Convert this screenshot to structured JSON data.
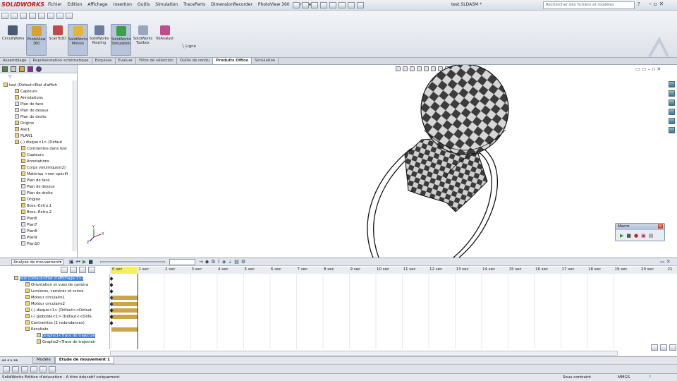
{
  "app": {
    "logo": "SOLIDWORKS",
    "doc_title": "test.SLDASM *"
  },
  "menu": [
    "Fichier",
    "Edition",
    "Affichage",
    "Insertion",
    "Outils",
    "Simulation",
    "TraceParts",
    "DimensionRecorder",
    "PhotoView 360",
    "Fenêtre"
  ],
  "search": {
    "placeholder": "Rechercher des fichiers et modèles"
  },
  "ribbon": {
    "buttons": [
      {
        "label": "CircuitWorks",
        "color": "#4a5b75",
        "active": false
      },
      {
        "label": "PhotoView 360",
        "color": "#d7a22d",
        "active": true
      },
      {
        "label": "ScanTo3D",
        "color": "#c44848",
        "active": false
      },
      {
        "label": "SolidWorks Motion",
        "color": "#e4b535",
        "active": true
      },
      {
        "label": "SolidWorks Routing",
        "color": "#6c7da0",
        "active": false
      },
      {
        "label": "SolidWorks Simulation",
        "color": "#3aa04a",
        "active": true
      },
      {
        "label": "SolidWorks Toolbox",
        "color": "#9aa8be",
        "active": false
      },
      {
        "label": "TolAnalyst",
        "color": "#c44a8e",
        "active": false
      }
    ],
    "ligne": "Ligne"
  },
  "tabs": [
    {
      "label": "Assemblage",
      "selected": false
    },
    {
      "label": "Représentation schématique",
      "selected": false
    },
    {
      "label": "Esquisse",
      "selected": false
    },
    {
      "label": "Evaluer",
      "selected": false
    },
    {
      "label": "Filtre de sélection",
      "selected": false
    },
    {
      "label": "Outils de rendu",
      "selected": false
    },
    {
      "label": "Produits Office",
      "selected": true
    },
    {
      "label": "Simulation",
      "selected": false
    }
  ],
  "feature_tree": [
    {
      "label": "test (Défaut<Etat d'affich",
      "level": 0
    },
    {
      "label": "Capteurs",
      "level": 1
    },
    {
      "label": "Annotations",
      "level": 1
    },
    {
      "label": "Plan de face",
      "level": 1
    },
    {
      "label": "Plan de dessus",
      "level": 1
    },
    {
      "label": "Plan de droite",
      "level": 1
    },
    {
      "label": "Origine",
      "level": 1
    },
    {
      "label": "Axe1",
      "level": 1
    },
    {
      "label": "PLAN1",
      "level": 1
    },
    {
      "label": "(-) disque<1> (Défaut",
      "level": 1
    },
    {
      "label": "Contraintes dans test",
      "level": 2
    },
    {
      "label": "Capteurs",
      "level": 2
    },
    {
      "label": "Annotations",
      "level": 2
    },
    {
      "label": "Corps volumiques(2)",
      "level": 2
    },
    {
      "label": "Matériau <non spécifi",
      "level": 2
    },
    {
      "label": "Plan de face",
      "level": 2
    },
    {
      "label": "Plan de dessus",
      "level": 2
    },
    {
      "label": "Plan de droite",
      "level": 2
    },
    {
      "label": "Origine",
      "level": 2
    },
    {
      "label": "Boss.-Extru.1",
      "level": 2
    },
    {
      "label": "Boss.-Extru.2",
      "level": 2
    },
    {
      "label": "Plan6",
      "level": 2
    },
    {
      "label": "Plan7",
      "level": 2
    },
    {
      "label": "Plan8",
      "level": 2
    },
    {
      "label": "Plan9",
      "level": 2
    },
    {
      "label": "Plan10",
      "level": 2
    }
  ],
  "macro": {
    "title": "Macro"
  },
  "motion": {
    "study_type": "Analyse de mouvement",
    "time_field": "",
    "ticks": [
      "0 sec",
      "1 sec",
      "2 sec",
      "3 sec",
      "4 sec",
      "5 sec",
      "6 sec",
      "7 sec",
      "8 sec",
      "9 sec",
      "10 sec",
      "11 sec",
      "12 sec",
      "13 sec",
      "14 sec",
      "15 sec",
      "16 sec",
      "17 sec",
      "18 sec",
      "19 sec",
      "20 sec",
      "21"
    ],
    "tree": [
      {
        "label": "test (Défaut<Etat d'affichage-1>)",
        "level": 0,
        "selected": true
      },
      {
        "label": "Orientation et vues de caméra",
        "level": 1
      },
      {
        "label": "Lumières, caméras et scène",
        "level": 1
      },
      {
        "label": "Moteur circulaire1",
        "level": 1
      },
      {
        "label": "Moteur circulaire2",
        "level": 1
      },
      {
        "label": "(-) disque<1> (Défaut<<Défaut",
        "level": 1
      },
      {
        "label": "(-) globoïde<1> (Défaut<<Défa",
        "level": 1
      },
      {
        "label": "Contraintes (2 redondances)",
        "level": 1
      },
      {
        "label": "Résultats",
        "level": 1
      },
      {
        "label": "Graphe1<Tracé de trajectoir",
        "level": 2,
        "selected": true
      },
      {
        "label": "Graphe2<Tracé de trajectoir",
        "level": 2
      }
    ]
  },
  "bottom_tabs": [
    {
      "label": "Modèle",
      "selected": false
    },
    {
      "label": "Etude de mouvement 1",
      "selected": true
    }
  ],
  "status": {
    "left": "SolidWorks Edition d'éducation - A titre éducatif uniquement",
    "constraint": "Sous-contraint",
    "units": "MMGS"
  }
}
